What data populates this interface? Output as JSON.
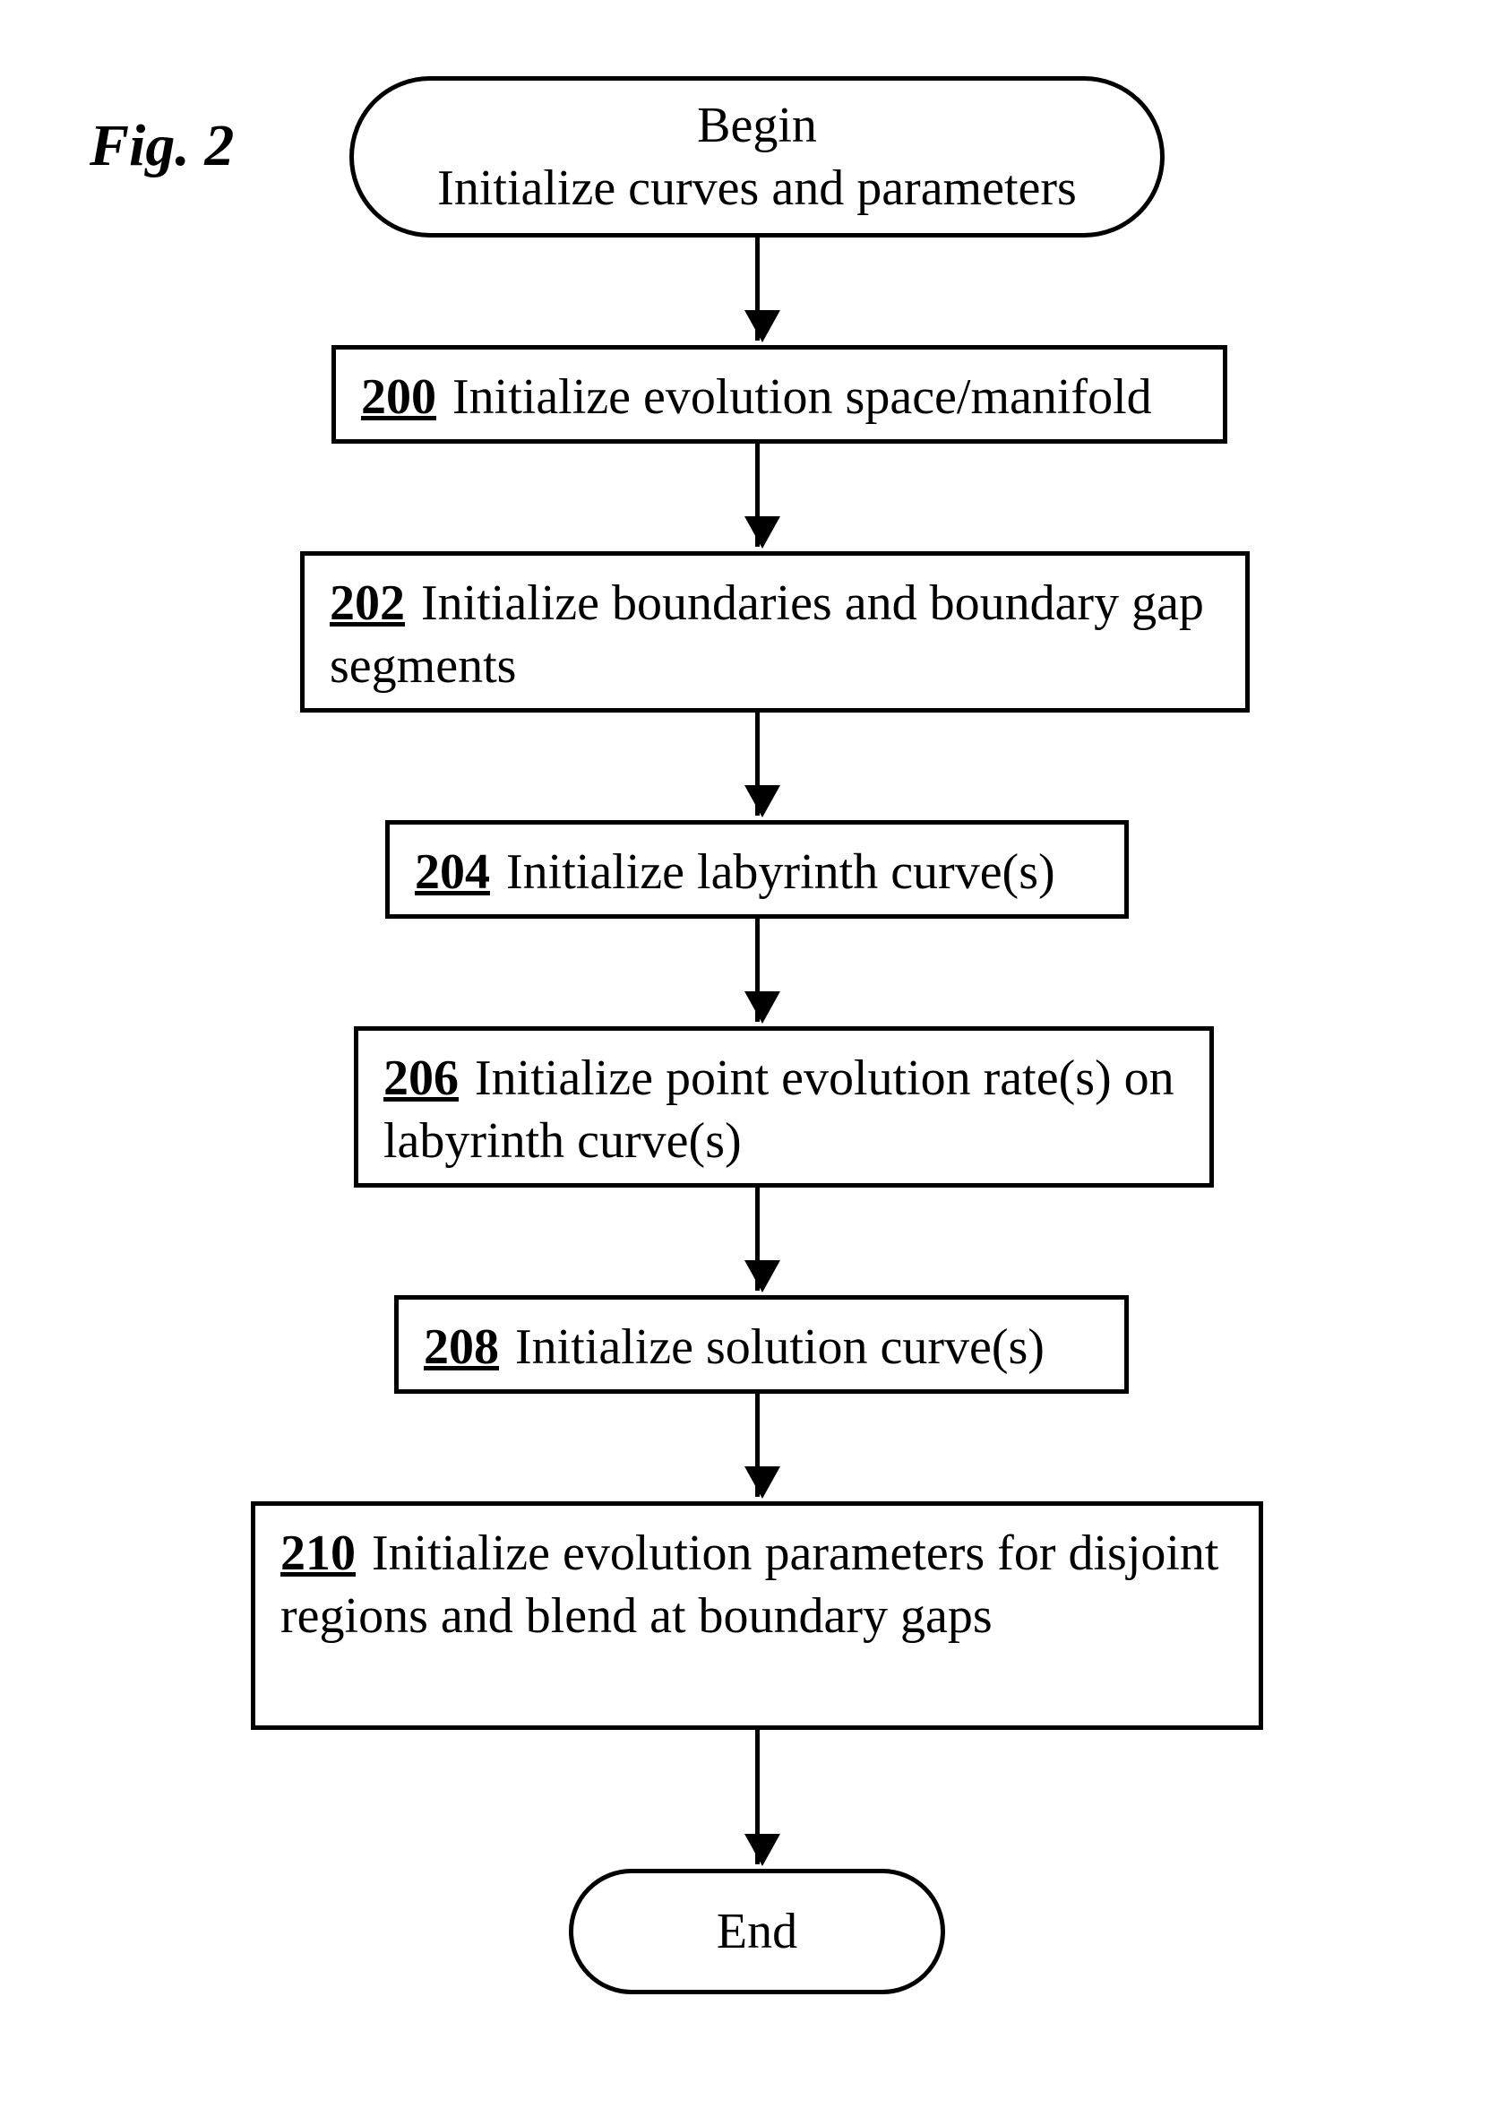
{
  "figure_label": "Fig. 2",
  "start": {
    "line1": "Begin",
    "line2": "Initialize curves and parameters"
  },
  "steps": [
    {
      "num": "200",
      "text": "Initialize evolution space/manifold"
    },
    {
      "num": "202",
      "text": "Initialize boundaries and boundary gap segments"
    },
    {
      "num": "204",
      "text": "Initialize labyrinth curve(s)"
    },
    {
      "num": "206",
      "text": "Initialize point evolution rate(s) on labyrinth curve(s)"
    },
    {
      "num": "208",
      "text": "Initialize solution curve(s)"
    },
    {
      "num": "210",
      "text": "Initialize evolution parameters for disjoint regions and blend at boundary gaps"
    }
  ],
  "end": "End"
}
